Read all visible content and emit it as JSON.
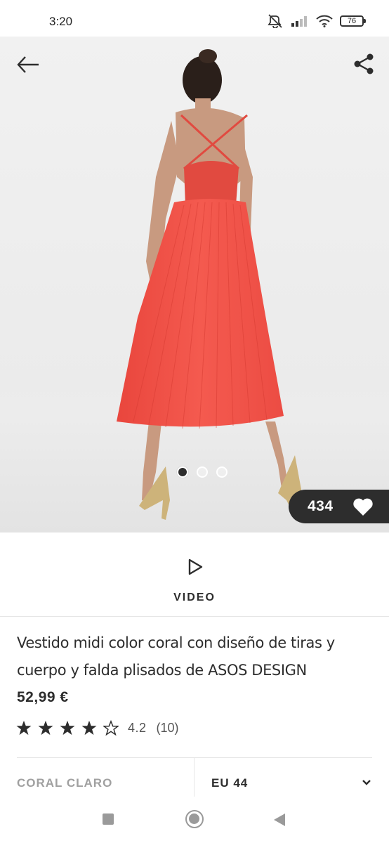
{
  "status_bar": {
    "time": "3:20",
    "battery": "76",
    "icons": [
      "mute-icon",
      "signal-icon",
      "wifi-icon",
      "battery-icon"
    ]
  },
  "hero": {
    "image_description_icon": "product-photo",
    "carousel_total": 3,
    "carousel_active": 1,
    "save_count": "434",
    "colors": {
      "dress": "#f2544a",
      "background": "#eeeeee",
      "pill": "#2d2d2d"
    }
  },
  "video": {
    "label": "VIDEO"
  },
  "product": {
    "name": "Vestido midi color coral con diseño de tiras y cuerpo y falda plisados de ASOS DESIGN",
    "price": "52,99 €",
    "rating_value": "4.2",
    "rating_count": "(10)",
    "stars_filled": 4,
    "stars_total": 5
  },
  "selectors": {
    "color_label": "CORAL CLARO",
    "size_label": "EU 44"
  }
}
